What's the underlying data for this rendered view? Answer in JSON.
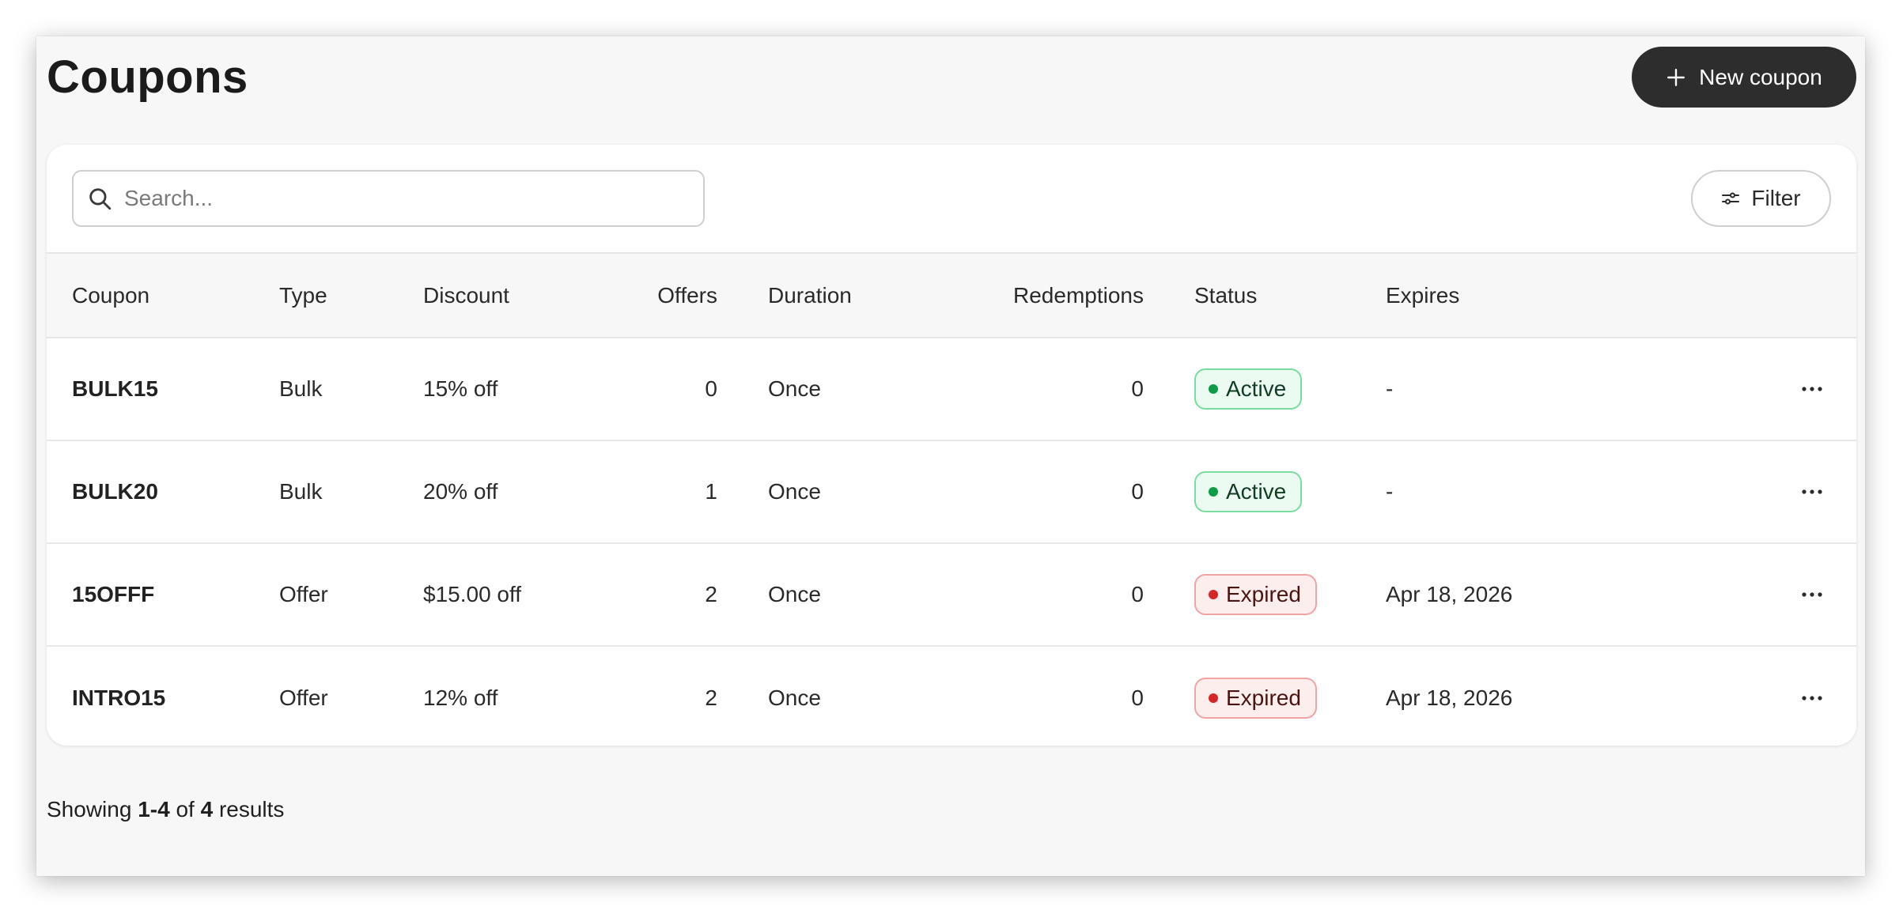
{
  "page": {
    "title": "Coupons",
    "new_button_label": "New coupon"
  },
  "toolbar": {
    "search_placeholder": "Search...",
    "filter_label": "Filter"
  },
  "table": {
    "headers": [
      "Coupon",
      "Type",
      "Discount",
      "Offers",
      "Duration",
      "Redemptions",
      "Status",
      "Expires"
    ],
    "rows": [
      {
        "coupon": "BULK15",
        "type": "Bulk",
        "discount": "15% off",
        "offers": "0",
        "duration": "Once",
        "redemptions": "0",
        "status": "Active",
        "expires": "-"
      },
      {
        "coupon": "BULK20",
        "type": "Bulk",
        "discount": "20% off",
        "offers": "1",
        "duration": "Once",
        "redemptions": "0",
        "status": "Active",
        "expires": "-"
      },
      {
        "coupon": "15OFFF",
        "type": "Offer",
        "discount": "$15.00 off",
        "offers": "2",
        "duration": "Once",
        "redemptions": "0",
        "status": "Expired",
        "expires": "Apr 18, 2026"
      },
      {
        "coupon": "INTRO15",
        "type": "Offer",
        "discount": "12% off",
        "offers": "2",
        "duration": "Once",
        "redemptions": "0",
        "status": "Expired",
        "expires": "Apr 18, 2026"
      }
    ]
  },
  "pagination": {
    "prefix": "Showing",
    "range": "1-4",
    "of": "of",
    "total": "4",
    "suffix": "results"
  },
  "icons": {
    "new_button": "plus-icon",
    "search": "search-icon",
    "filter": "sliders-icon",
    "row_action": "more-horizontal-icon"
  },
  "colors": {
    "primary_button": "#2d2d2d",
    "active_badge_bg": "#ecfbf1",
    "active_badge_border": "#7bdc9f",
    "active_dot": "#0f9a47",
    "expired_badge_bg": "#fdeeee",
    "expired_badge_border": "#f2a3a3",
    "expired_dot": "#d72626"
  }
}
